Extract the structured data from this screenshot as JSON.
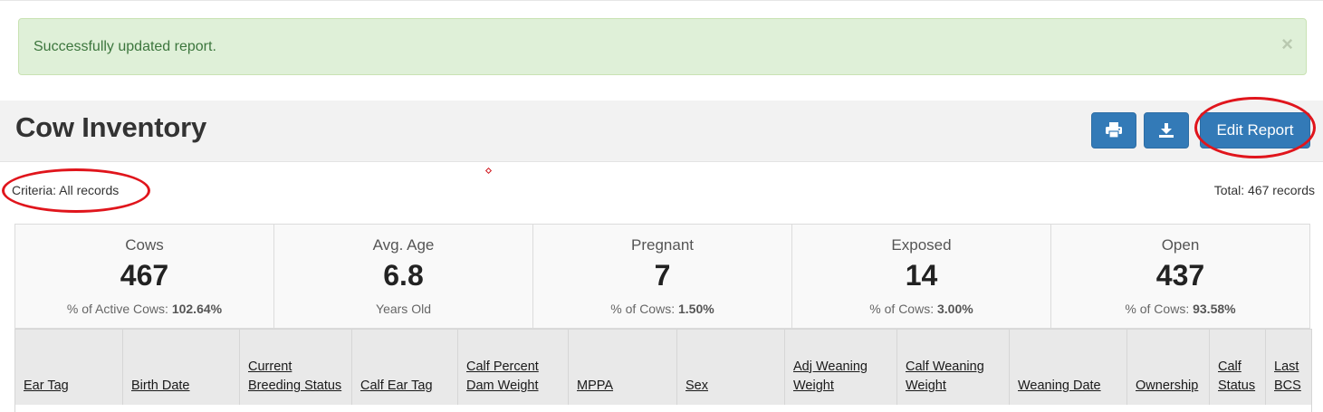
{
  "alert": {
    "message": "Successfully updated report.",
    "close": "×"
  },
  "header": {
    "title": "Cow Inventory",
    "edit_label": "Edit Report"
  },
  "criteria": "Criteria: All records",
  "total": "Total: 467 records",
  "stats": [
    {
      "label": "Cows",
      "value": "467",
      "sub_label": "% of Active Cows:",
      "sub_value": "102.64%"
    },
    {
      "label": "Avg. Age",
      "value": "6.8",
      "sub_label": "Years Old",
      "sub_value": ""
    },
    {
      "label": "Pregnant",
      "value": "7",
      "sub_label": "% of Cows:",
      "sub_value": "1.50%"
    },
    {
      "label": "Exposed",
      "value": "14",
      "sub_label": "% of Cows:",
      "sub_value": "3.00%"
    },
    {
      "label": "Open",
      "value": "437",
      "sub_label": "% of Cows:",
      "sub_value": "93.58%"
    }
  ],
  "columns": [
    "Ear Tag",
    "Birth Date",
    "Current Breeding Status",
    "Calf Ear Tag",
    "Calf Percent Dam Weight",
    "MPPA",
    "Sex",
    "Adj Weaning Weight",
    "Calf Weaning Weight",
    "Weaning Date",
    "Ownership",
    "Calf Status",
    "Last BCS"
  ],
  "colors": {
    "alert_bg": "#dff0d8",
    "alert_text": "#3c763d",
    "primary": "#337ab7",
    "annotation": "#e0151c"
  },
  "icons": [
    "close-icon",
    "print-icon",
    "download-icon"
  ]
}
